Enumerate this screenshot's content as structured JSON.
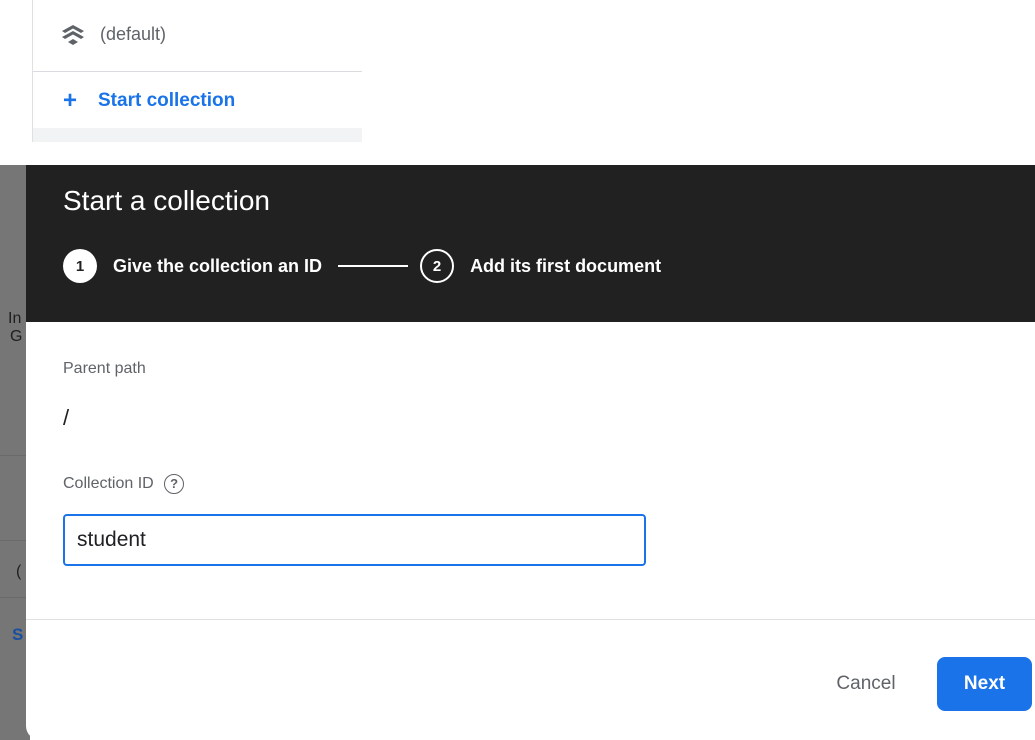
{
  "panel": {
    "database_label": "(default)",
    "start_collection_label": "Start collection",
    "database_icon": "firestore-database-icon",
    "add_icon": "plus-icon"
  },
  "background": {
    "fragments": [
      "In",
      "G",
      "(",
      "S"
    ]
  },
  "dialog": {
    "title": "Start a collection",
    "steps": [
      {
        "number": "1",
        "label": "Give the collection an ID",
        "state": "active"
      },
      {
        "number": "2",
        "label": "Add its first document",
        "state": "inactive"
      }
    ],
    "parent_path_label": "Parent path",
    "parent_path_value": "/",
    "collection_id_label": "Collection ID",
    "help_icon": "help-circle-icon",
    "collection_id_value": "student",
    "cancel_label": "Cancel",
    "next_label": "Next"
  },
  "colors": {
    "accent": "#1a73e8",
    "header_bg": "#212121",
    "backdrop": "#767676"
  }
}
